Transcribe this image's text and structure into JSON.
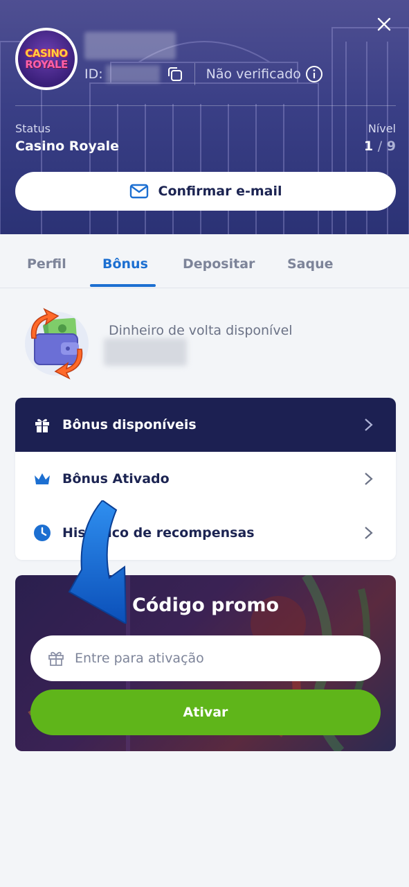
{
  "header": {
    "logo_text": [
      "CASINO",
      "ROYALE"
    ],
    "id_label": "ID:",
    "verification_status": "Não verificado",
    "status_label": "Status",
    "status_value": "Casino Royale",
    "level_label": "Nível",
    "level_current": "1",
    "level_separator": "/",
    "level_total": "9",
    "confirm_email_label": "Confirmar e-mail"
  },
  "tabs": [
    {
      "label": "Perfil",
      "active": false
    },
    {
      "label": "Bônus",
      "active": true
    },
    {
      "label": "Depositar",
      "active": false
    },
    {
      "label": "Saque",
      "active": false
    }
  ],
  "cashback": {
    "title": "Dinheiro de volta disponível"
  },
  "bonus_menu": {
    "items": [
      {
        "label": "Bônus disponíveis",
        "icon": "gift-icon"
      },
      {
        "label": "Bônus Ativado",
        "icon": "crown-icon"
      },
      {
        "label": "Histórico de recompensas",
        "icon": "clock-icon"
      }
    ]
  },
  "promo": {
    "title": "Código promo",
    "placeholder": "Entre para ativação",
    "button_label": "Ativar"
  },
  "colors": {
    "accent": "#1c6fd1",
    "header_bg": "#3a3f86",
    "menu_dark": "#1c2052",
    "activate_green": "#5fb51a"
  }
}
